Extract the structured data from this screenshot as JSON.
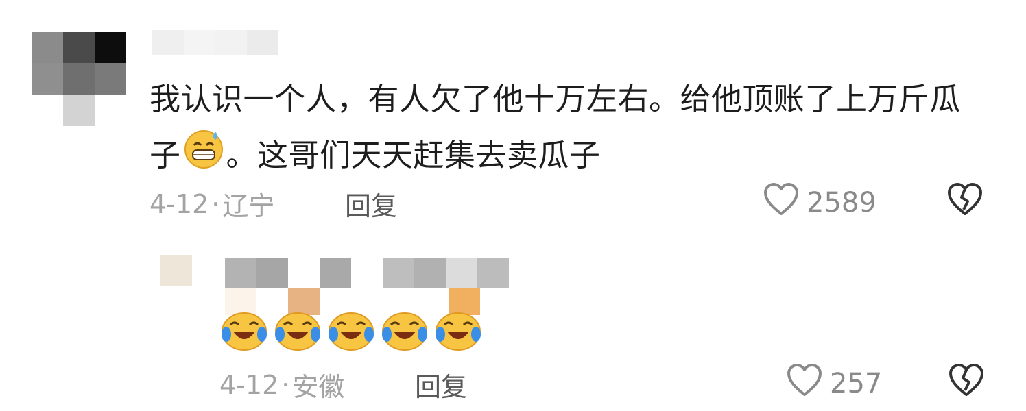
{
  "comments": [
    {
      "text": "我认识一个人，有人欠了他十万左右。给他顶账了上万斤瓜子",
      "text_after_emoji": "。这哥们天天赶集去卖瓜子",
      "emoji": "sweat-grin-emoji",
      "date": "4-12",
      "separator": "·",
      "location": "辽宁",
      "reply_label": "回复",
      "likes": "2589",
      "icons": {
        "like": "heart-outline-icon",
        "dislike": "broken-heart-icon"
      }
    },
    {
      "emoji": "laughing-crying-emoji",
      "emoji_count": 5,
      "date": "4-12",
      "separator": "·",
      "location": "安徽",
      "reply_label": "回复",
      "likes": "257",
      "icons": {
        "like": "heart-outline-icon",
        "dislike": "broken-heart-icon"
      }
    }
  ],
  "colors": {
    "text": "#1d1d1d",
    "meta": "#a3a3a3",
    "reply": "#5a5a5a",
    "count": "#8a8a8a"
  }
}
